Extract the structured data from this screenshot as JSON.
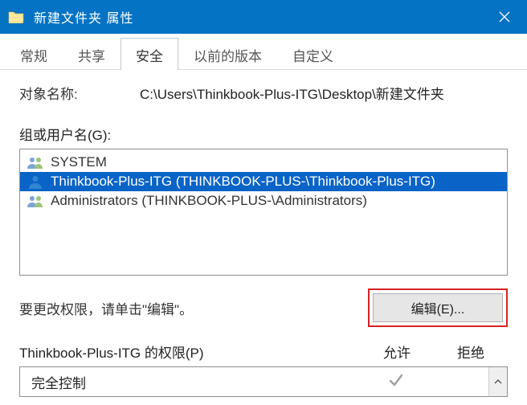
{
  "window": {
    "title": "新建文件夹 属性"
  },
  "tabs": [
    {
      "label": "常规",
      "active": false
    },
    {
      "label": "共享",
      "active": false
    },
    {
      "label": "安全",
      "active": true
    },
    {
      "label": "以前的版本",
      "active": false
    },
    {
      "label": "自定义",
      "active": false
    }
  ],
  "object": {
    "label": "对象名称:",
    "path": "C:\\Users\\Thinkbook-Plus-ITG\\Desktop\\新建文件夹"
  },
  "groups": {
    "label": "组或用户名(G):",
    "items": [
      {
        "name": "SYSTEM",
        "icon": "group",
        "selected": false
      },
      {
        "name": "Thinkbook-Plus-ITG (THINKBOOK-PLUS-\\Thinkbook-Plus-ITG)",
        "icon": "user",
        "selected": true
      },
      {
        "name": "Administrators (THINKBOOK-PLUS-\\Administrators)",
        "icon": "group",
        "selected": false
      }
    ]
  },
  "editHint": "要更改权限，请单击\"编辑\"。",
  "editButton": "编辑(E)...",
  "permissions": {
    "header": "Thinkbook-Plus-ITG 的权限(P)",
    "allowLabel": "允许",
    "denyLabel": "拒绝",
    "rows": [
      {
        "name": "完全控制",
        "allow": true,
        "deny": false
      }
    ]
  }
}
